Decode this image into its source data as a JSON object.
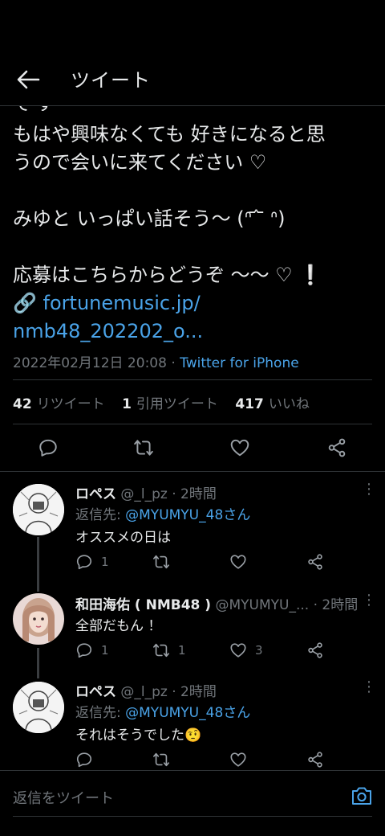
{
  "header": {
    "title": "ツイート"
  },
  "tweet": {
    "cut_fragment": "て す",
    "line1": "もはや興味なくても 好きになると思",
    "line2": "うので会いに来てください ♡",
    "line3": "みゆと いっぱい話そう〜 (ᐢ ᷄ ᷅ ᐢ)",
    "line4": "応募はこちらからどうぞ 〜〜 ♡ ❕",
    "link_emoji": "🔗",
    "link_line1": "fortunemusic.jp/",
    "link_line2": "nmb48_202202_o...",
    "timestamp": "2022年02月12日 20:08 ·",
    "source": "Twitter for iPhone"
  },
  "stats": {
    "retweets_count": "42",
    "retweets_label": "リツイート",
    "quotes_count": "1",
    "quotes_label": "引用ツイート",
    "likes_count": "417",
    "likes_label": "いいね"
  },
  "replies": [
    {
      "name": "ロペス",
      "handle_time": "@_l_pz · 2時間",
      "reply_to_label": "返信先: ",
      "reply_to": "@MYUMYU_48さん",
      "text": "オススメの日は",
      "replies": "1",
      "retweets": "",
      "likes": ""
    },
    {
      "name": "和田海佑 ( NMB48 )",
      "handle_time": "@MYUMYU_... · 2時間",
      "text": "全部だもん ！",
      "replies": "1",
      "retweets": "1",
      "likes": "3"
    },
    {
      "name": "ロペス",
      "handle_time": "@_l_pz · 2時間",
      "reply_to_label": "返信先: ",
      "reply_to": "@MYUMYU_48さん",
      "text": "それはそうでした🤨",
      "replies": "",
      "retweets": "",
      "likes": ""
    }
  ],
  "footer": {
    "placeholder": "返信をツイート"
  },
  "icons": {
    "back": "arrow-left-icon",
    "reply": "speech-bubble-icon",
    "retweet": "retweet-arrows-icon",
    "like": "heart-icon",
    "share": "share-icon",
    "more": "vertical-dots-icon",
    "camera": "camera-icon"
  },
  "colors": {
    "background": "#000000",
    "text": "#e7e9ea",
    "muted": "#71767b",
    "link": "#4aa3e8",
    "divider": "#2f3336"
  }
}
